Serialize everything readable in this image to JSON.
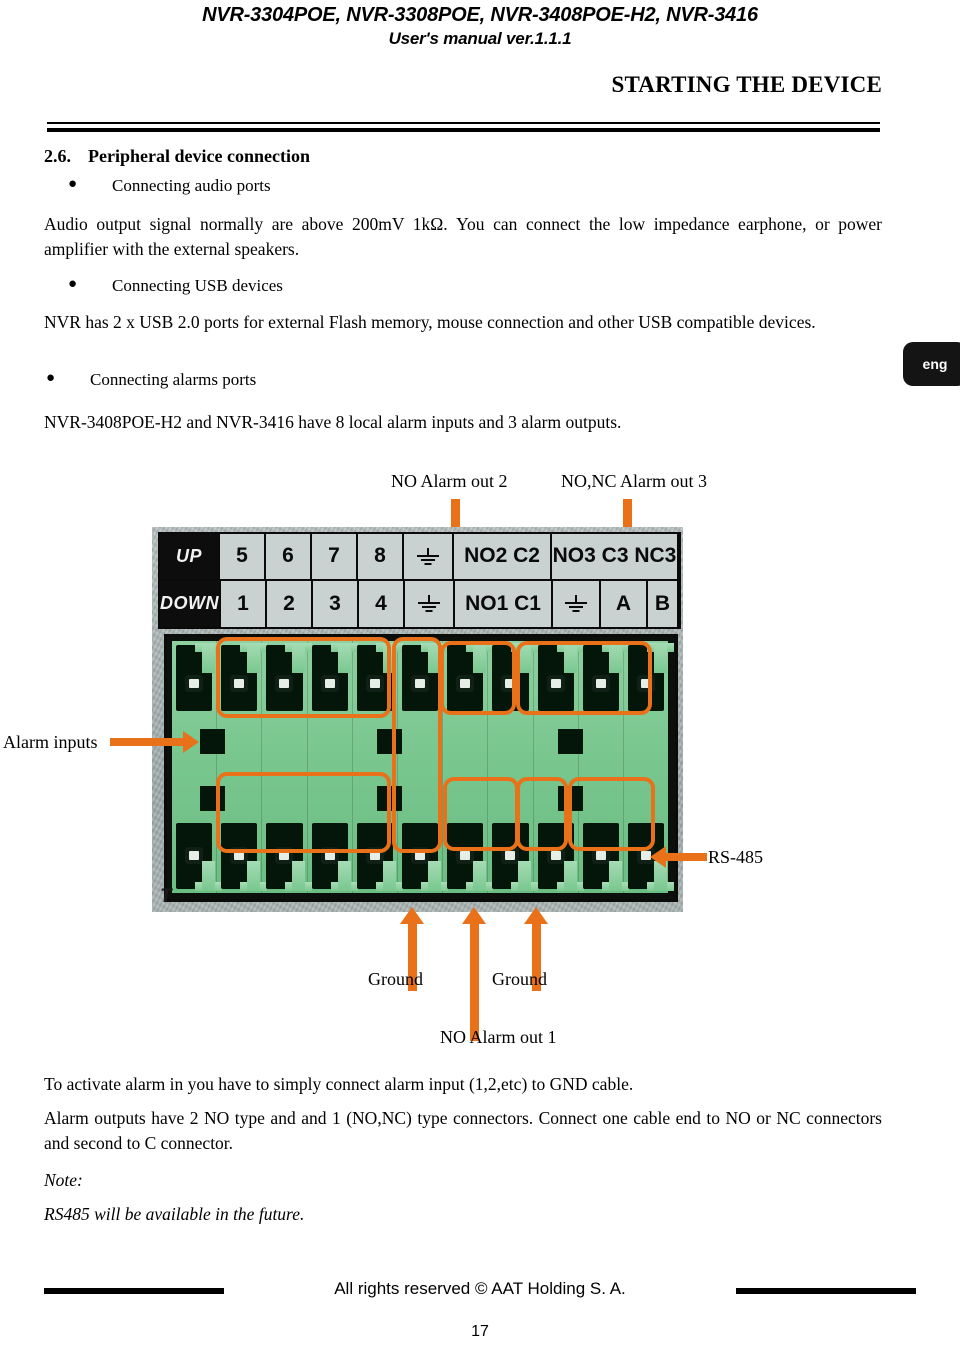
{
  "header": {
    "product_line": "NVR-3304POE, NVR-3308POE, NVR-3408POE-H2, NVR-3416",
    "manual_line": "User's manual ver.1.1.1",
    "section_header": "STARTING THE DEVICE"
  },
  "language_tab": {
    "label": "eng"
  },
  "content": {
    "section_number": "2.6.",
    "section_title": "Peripheral device connection",
    "bullets": [
      {
        "label": "Connecting audio ports"
      },
      {
        "label": "Connecting USB devices"
      },
      {
        "label": "Connecting alarms ports"
      }
    ],
    "paragraphs": [
      "Audio output signal normally are above 200mV 1kΩ. You can connect the low impedance earphone, or  power amplifier with the external speakers.",
      "NVR has 2 x USB 2.0 ports for external Flash memory, mouse connection and other USB compatible devices.",
      "NVR-3408POE-H2 and NVR-3416 have 8 local alarm inputs and 3 alarm outputs.",
      "To activate alarm in you have to simply connect alarm input (1,2,etc) to GND cable.",
      "Alarm outputs have 2 NO type and  and 1 (NO,NC) type connectors. Connect one cable end to NO or NC connectors and second to C connector.",
      "Note:",
      "RS485 will be available in the future."
    ]
  },
  "diagram": {
    "callouts": {
      "no_alarm_out_2": "NO Alarm out 2",
      "no_nc_alarm_out_3": "NO,NC Alarm out 3",
      "alarm_inputs": "Alarm inputs",
      "rs485": "RS-485",
      "ground_left": "Ground",
      "ground_right": "Ground",
      "no_alarm_out_1": "NO Alarm out 1"
    },
    "terminal_plate": {
      "row_up": [
        "UP",
        "5",
        "6",
        "7",
        "8",
        "ground-symbol",
        "NO2 C2",
        "NO3 C3 NC3"
      ],
      "row_down": [
        "DOWN",
        "1",
        "2",
        "3",
        "4",
        "ground-symbol",
        "NO1 C1",
        "ground-symbol",
        "A",
        "B"
      ]
    },
    "pcb_mark": "T",
    "colors": {
      "annotation_orange": "#E8711A",
      "connector_green": "#79C78F",
      "metal_gray": "#A9B4B3"
    }
  },
  "footer": {
    "copyright": "All rights reserved © AAT Holding S. A.",
    "page_number": "17"
  }
}
